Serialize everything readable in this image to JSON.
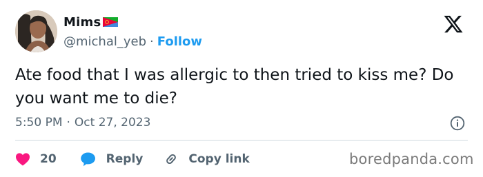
{
  "author": {
    "display_name": "Mims",
    "flag_icon": "eritrea-flag-emoji",
    "handle": "@michal_yeb",
    "separator": "·",
    "follow_label": "Follow"
  },
  "tweet": {
    "text": "Ate food that I was allergic to then tried to kiss me? Do you want me to die?",
    "time": "5:50 PM",
    "separator": "·",
    "date": "Oct 27, 2023"
  },
  "actions": {
    "like_count": "20",
    "reply_label": "Reply",
    "copy_link_label": "Copy link"
  },
  "watermark": "boredpanda.com",
  "colors": {
    "accent": "#1d9bf0",
    "like": "#f91880",
    "text": "#0f1419",
    "muted": "#536471"
  }
}
